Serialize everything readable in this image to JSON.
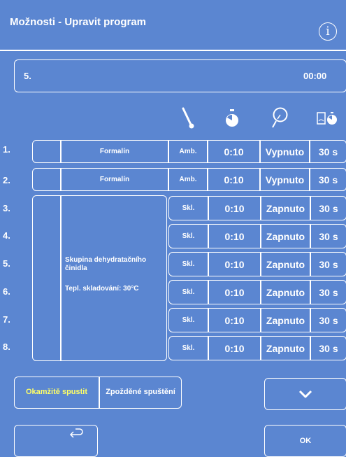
{
  "header": {
    "title": "Možnosti - Upravit program",
    "info_glyph": "i"
  },
  "program": {
    "number": "5.",
    "time": "00:00"
  },
  "column_icons": [
    "thermometer-icon",
    "stopwatch-icon",
    "pressure-vacuum-icon",
    "drain-timer-icon"
  ],
  "rows": [
    {
      "num": "1.",
      "temp": "Amb.",
      "time": "0:10",
      "pv": "Vypnuto",
      "drain": "30 s"
    },
    {
      "num": "2.",
      "temp": "Amb.",
      "time": "0:10",
      "pv": "Vypnuto",
      "drain": "30 s"
    },
    {
      "num": "3.",
      "temp": "Skl.",
      "time": "0:10",
      "pv": "Zapnuto",
      "drain": "30 s"
    },
    {
      "num": "4.",
      "temp": "Skl.",
      "time": "0:10",
      "pv": "Zapnuto",
      "drain": "30 s"
    },
    {
      "num": "5.",
      "temp": "Skl.",
      "time": "0:10",
      "pv": "Zapnuto",
      "drain": "30 s"
    },
    {
      "num": "6.",
      "temp": "Skl.",
      "time": "0:10",
      "pv": "Zapnuto",
      "drain": "30 s"
    },
    {
      "num": "7.",
      "temp": "Skl.",
      "time": "0:10",
      "pv": "Zapnuto",
      "drain": "30 s"
    },
    {
      "num": "8.",
      "temp": "Skl.",
      "time": "0:10",
      "pv": "Zapnuto",
      "drain": "30 s"
    }
  ],
  "reagents": {
    "row1": "Formalín",
    "row2": "Formalín",
    "group_name": "Skupina dehydratačního činidla",
    "group_temp": "Tepl. skladování: 30°C"
  },
  "buttons": {
    "start_now": "Okamžitě spustit",
    "delayed": "Zpožděné spuštění",
    "ok": "OK"
  },
  "colors": {
    "background": "#5b86d1",
    "accent": "#ffff66",
    "border": "#ffffff"
  }
}
